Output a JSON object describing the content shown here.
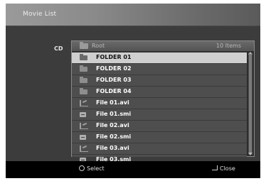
{
  "window": {
    "title": "Movie List"
  },
  "device": {
    "label": "CD"
  },
  "list": {
    "root_label": "Root",
    "count_label": "10 Items",
    "items": [
      {
        "label": "FOLDER 01",
        "icon": "folder-icon",
        "selected": true
      },
      {
        "label": "FOLDER 02",
        "icon": "folder-icon",
        "selected": false
      },
      {
        "label": "FOLDER 03",
        "icon": "folder-icon",
        "selected": false
      },
      {
        "label": "FOLDER 04",
        "icon": "folder-icon",
        "selected": false
      },
      {
        "label": "File 01.avi",
        "icon": "video-file-icon",
        "selected": false
      },
      {
        "label": "File 01.smi",
        "icon": "subtitle-file-icon",
        "selected": false
      },
      {
        "label": "File 02.avi",
        "icon": "video-file-icon",
        "selected": false
      },
      {
        "label": "File 02.smi",
        "icon": "subtitle-file-icon",
        "selected": false
      },
      {
        "label": "File 03.avi",
        "icon": "video-file-icon",
        "selected": false
      },
      {
        "label": "File 03.smi",
        "icon": "subtitle-file-icon",
        "selected": false
      }
    ]
  },
  "footer": {
    "select_label": "Select",
    "close_label": "Close"
  },
  "colors": {
    "panel": "#3c3c3c",
    "row": "#4e4e4e",
    "selected_row": "#cfcfcf",
    "text": "#ffffff"
  }
}
